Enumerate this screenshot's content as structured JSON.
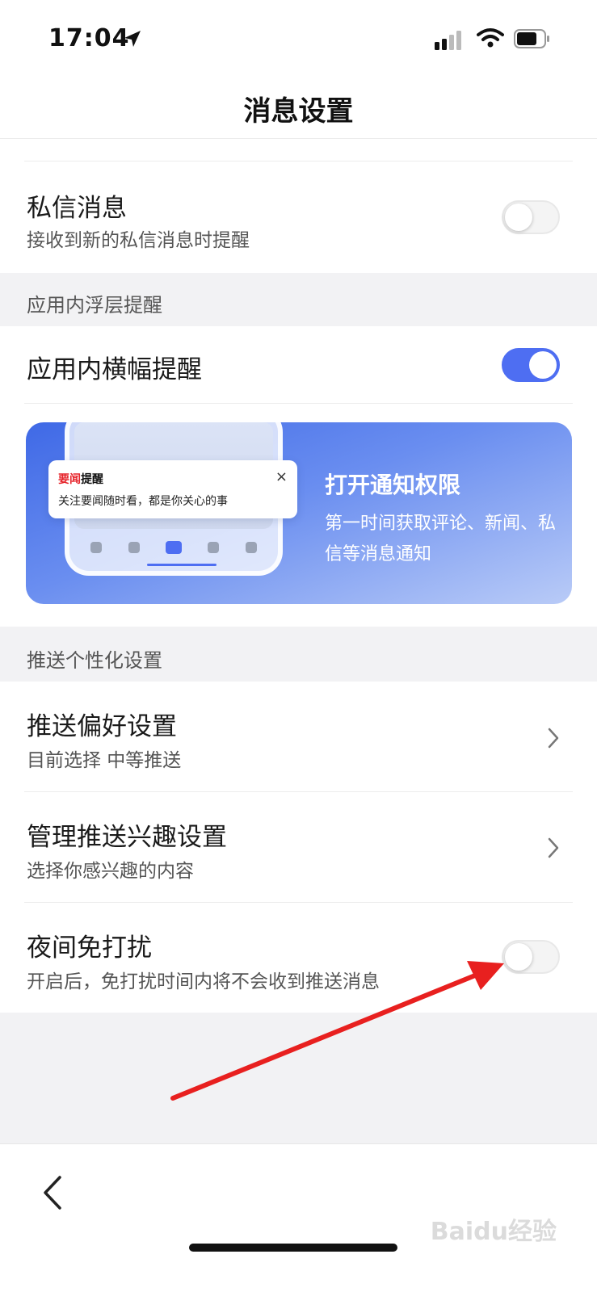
{
  "status_bar": {
    "time": "17:04",
    "location_icon": "location-arrow-icon",
    "signal_icon": "cellular-signal-icon",
    "wifi_icon": "wifi-icon",
    "battery_icon": "battery-icon"
  },
  "header": {
    "title": "消息设置"
  },
  "private_message": {
    "title": "私信消息",
    "subtitle": "接收到新的私信消息时提醒",
    "enabled": false
  },
  "in_app_section": {
    "header": "应用内浮层提醒",
    "banner_toggle_title": "应用内横幅提醒",
    "banner_toggle_enabled": true
  },
  "promo_banner": {
    "brand_red": "要闻",
    "brand_black": "提醒",
    "notification_text": "关注要闻随时看，都是你关心的事",
    "close_symbol": "×",
    "title": "打开通知权限",
    "description": "第一时间获取评论、新闻、私信等消息通知"
  },
  "push_section": {
    "header": "推送个性化设置",
    "items": [
      {
        "title": "推送偏好设置",
        "subtitle": "目前选择 中等推送"
      },
      {
        "title": "管理推送兴趣设置",
        "subtitle": "选择你感兴趣的内容"
      }
    ],
    "night_mode": {
      "title": "夜间免打扰",
      "subtitle": "开启后，免打扰时间内将不会收到推送消息",
      "enabled": false
    }
  },
  "watermark": "Baidu经验",
  "colors": {
    "accent": "#4e6ef2",
    "annotation_arrow": "#e8201f"
  }
}
